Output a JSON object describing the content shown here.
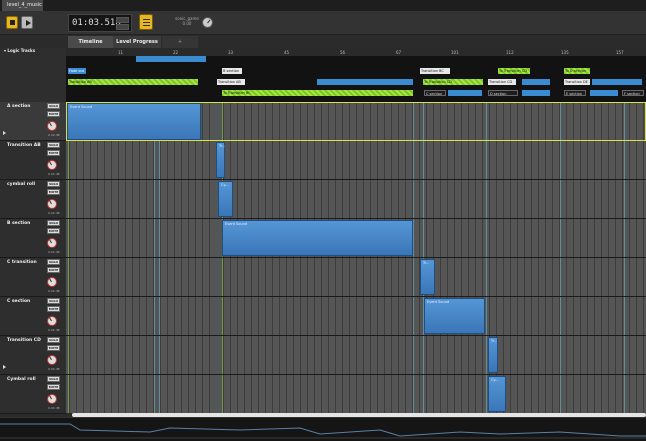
{
  "title_tab": "level_4_music",
  "transport": {
    "time": "01:03.518",
    "sonic_label_1": "sonic_game",
    "sonic_label_2": "0.00"
  },
  "tabs": [
    {
      "label": "Timeline",
      "active": true
    },
    {
      "label": "Level Progress",
      "active": false
    },
    {
      "label": "+",
      "active": false
    }
  ],
  "logic_tracks_label": "Logic Tracks",
  "ruler_ticks": [
    "11",
    "22",
    "33",
    "45",
    "56",
    "67",
    "78",
    "90",
    "101",
    "112",
    "123",
    "135",
    "146",
    "157"
  ],
  "markers": [
    {
      "label": "Fade out",
      "style": "blue"
    },
    {
      "label": "Transition AB",
      "style": "green"
    },
    {
      "label": "B section",
      "style": "white"
    },
    {
      "label": "Transition AB",
      "style": "white"
    },
    {
      "label": "To Transition BC",
      "style": "green"
    },
    {
      "label": "Transition BC",
      "style": "white"
    },
    {
      "label": "To Transition CD",
      "style": "green"
    },
    {
      "label": "C section",
      "style": "dark"
    },
    {
      "label": "Transition CD",
      "style": "white"
    },
    {
      "label": "To Transition CD",
      "style": "green"
    },
    {
      "label": "D section",
      "style": "dark"
    },
    {
      "label": "To D section",
      "style": "green"
    },
    {
      "label": "Transition DE",
      "style": "white"
    },
    {
      "label": "E section",
      "style": "dark"
    },
    {
      "label": "F section",
      "style": "dark"
    }
  ],
  "tracks": [
    {
      "name": "A section",
      "solo": "SOLO",
      "mute": "MUTE",
      "value": "0.00 dB",
      "clip": "Event Sound"
    },
    {
      "name": "Transition AB",
      "solo": "SOLO",
      "mute": "MUTE",
      "value": "0.00 dB",
      "clip": "Tr..."
    },
    {
      "name": "cymbal roll",
      "solo": "SOLO",
      "mute": "MUTE",
      "value": "0.00 dB",
      "clip": "Cy..."
    },
    {
      "name": "B section",
      "solo": "SOLO",
      "mute": "MUTE",
      "value": "0.00 dB",
      "clip": "Event Sound"
    },
    {
      "name": "C transition",
      "solo": "SOLO",
      "mute": "MUTE",
      "value": "0.00 dB",
      "clip": "Tr..."
    },
    {
      "name": "C section",
      "solo": "SOLO",
      "mute": "MUTE",
      "value": "0.00 dB",
      "clip": "Event Sound"
    },
    {
      "name": "Transition CD",
      "solo": "SOLO",
      "mute": "MUTE",
      "value": "0.00 dB",
      "clip": "Tr..."
    },
    {
      "name": "Cymbal roll",
      "solo": "SOLO",
      "mute": "MUTE",
      "value": "0.00 dB",
      "clip": "Cy..."
    }
  ],
  "colors": {
    "accent_yellow": "#e6b722",
    "clip_blue": "#3b8bd1",
    "marker_green": "#7cc91c",
    "selection": "#d8e04a"
  }
}
